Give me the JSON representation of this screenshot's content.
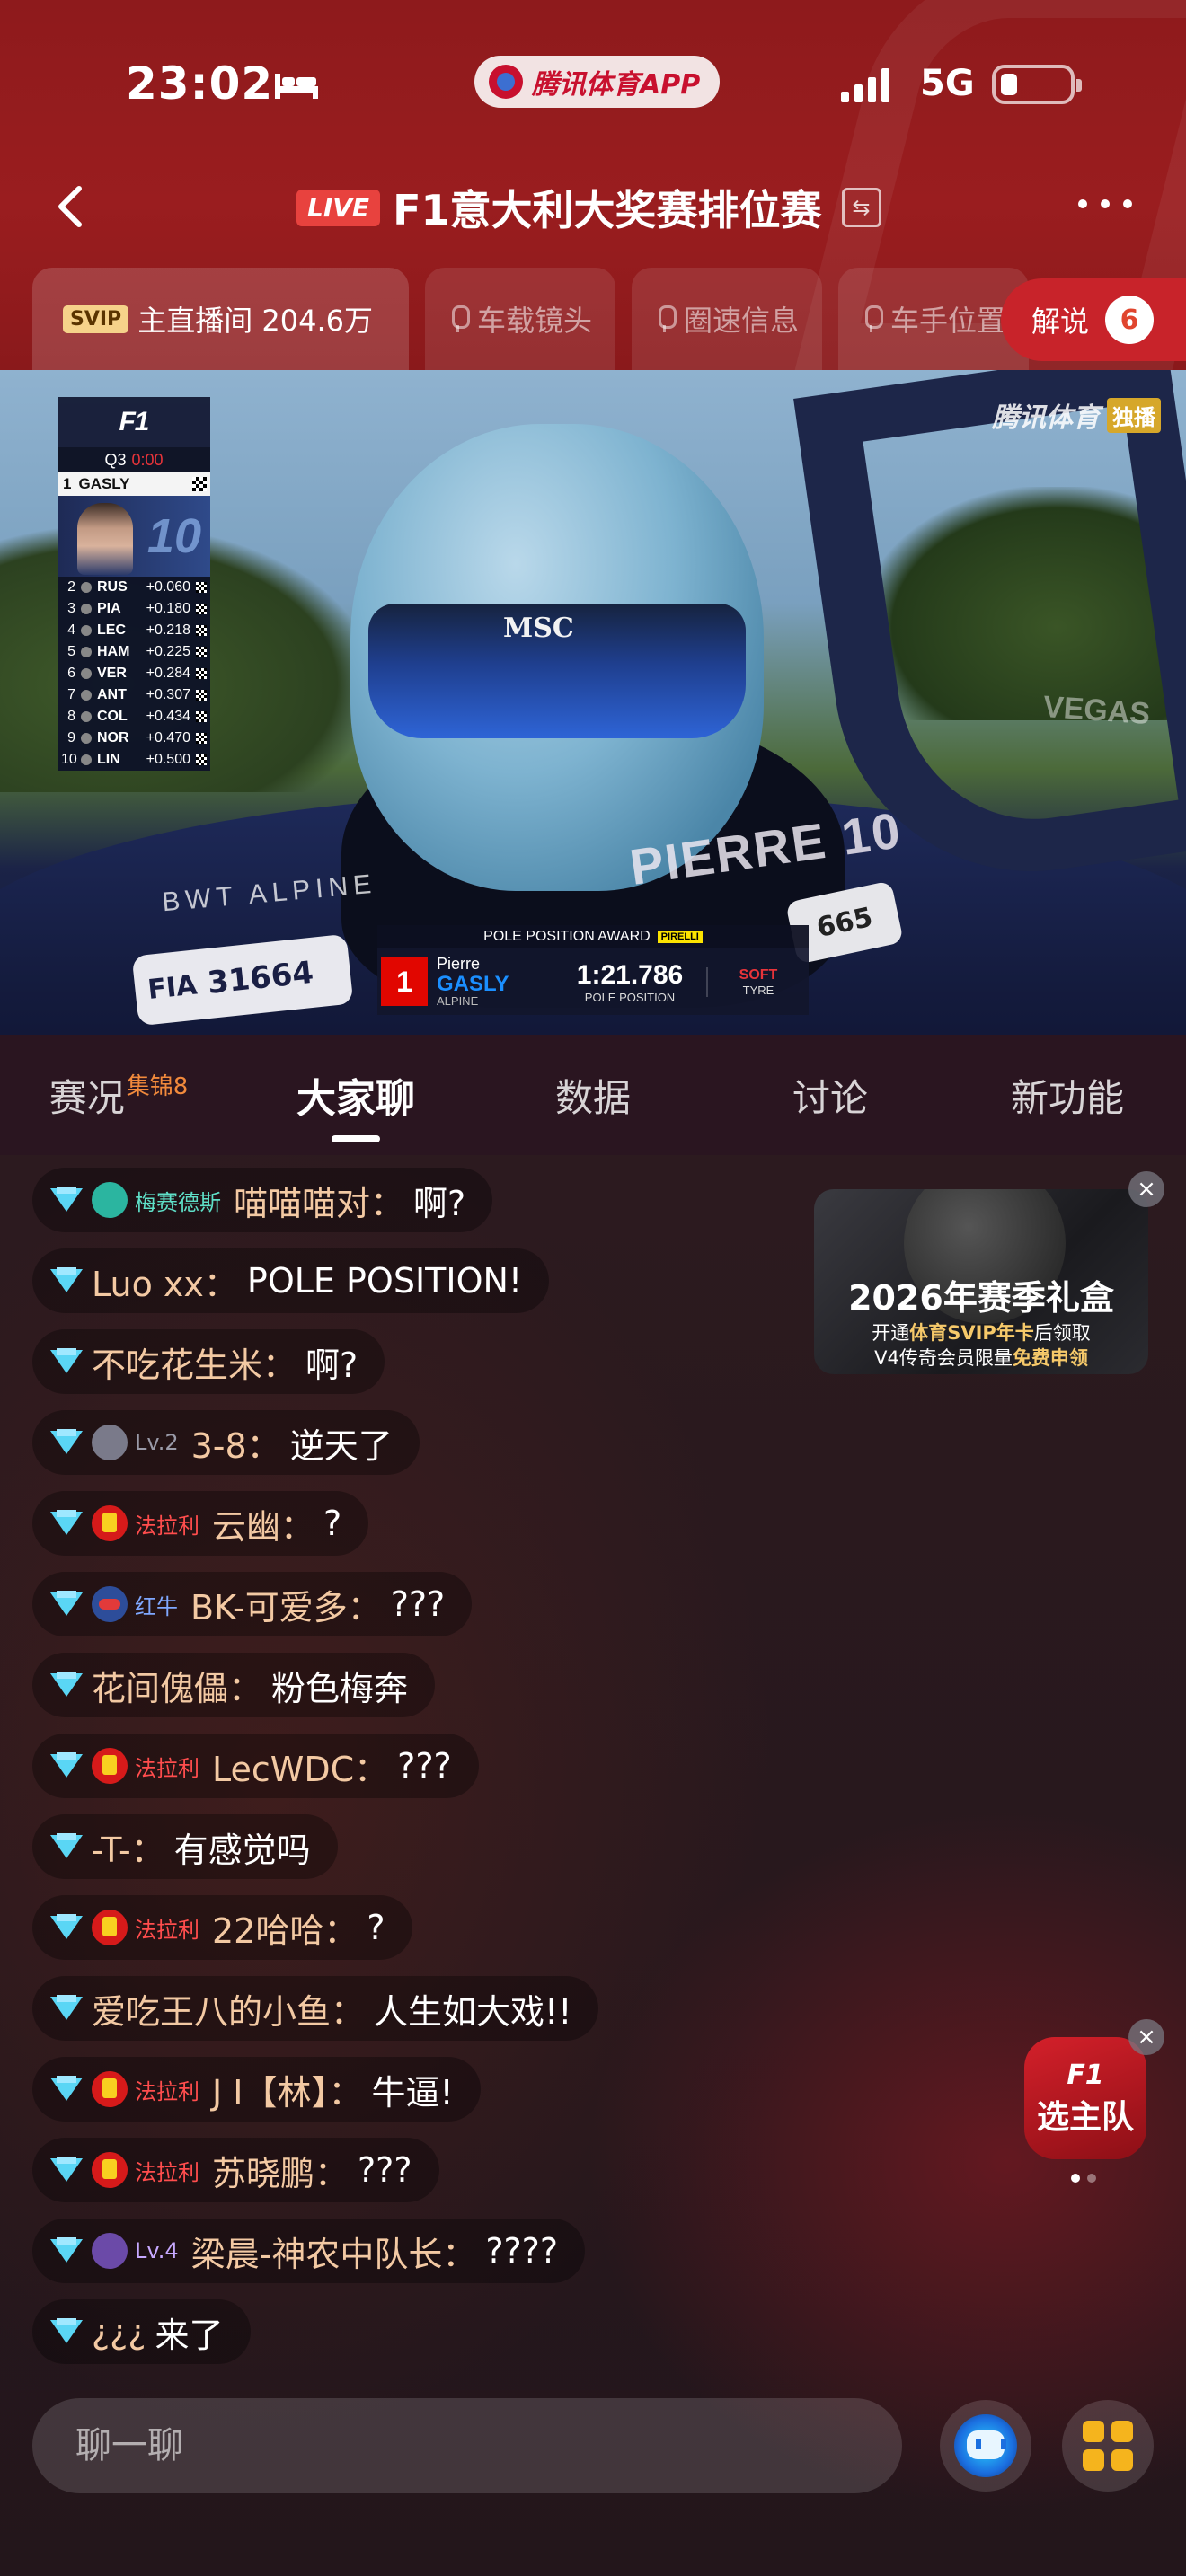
{
  "status_bar": {
    "time": "23:02",
    "network": "5G"
  },
  "app_pill": {
    "label": "腾讯体育APP"
  },
  "header": {
    "live_badge": "LIVE",
    "title": "F1意大利大奖赛排位赛"
  },
  "camera_tabs": [
    {
      "badge": "SVIP",
      "label": "主直播间 204.6万",
      "active": true
    },
    {
      "label": "车载镜头",
      "active": false
    },
    {
      "label": "圈速信息",
      "active": false
    },
    {
      "label": "车手位置",
      "active": false
    }
  ],
  "commentary": {
    "label": "解说",
    "count": "6"
  },
  "video": {
    "watermark": "腾讯体育",
    "watermark_tag": "独播",
    "helmet_brand": "MSC",
    "car_name": "PIERRE 10",
    "car_team": "BWT ALPINE",
    "fia_label": "FIA",
    "fia_number": "31664",
    "right_plate": "665",
    "trackside_ad": "VEGAS",
    "timing_tower": {
      "f1_logo": "F1",
      "session": "Q3",
      "clock": "0:00",
      "leader": {
        "pos": "1",
        "driver": "GASLY"
      },
      "photo_number": "10",
      "rows": [
        {
          "pos": "2",
          "driver": "RUS",
          "gap": "+0.060"
        },
        {
          "pos": "3",
          "driver": "PIA",
          "gap": "+0.180"
        },
        {
          "pos": "4",
          "driver": "LEC",
          "gap": "+0.218"
        },
        {
          "pos": "5",
          "driver": "HAM",
          "gap": "+0.225"
        },
        {
          "pos": "6",
          "driver": "VER",
          "gap": "+0.284"
        },
        {
          "pos": "7",
          "driver": "ANT",
          "gap": "+0.307"
        },
        {
          "pos": "8",
          "driver": "COL",
          "gap": "+0.434"
        },
        {
          "pos": "9",
          "driver": "NOR",
          "gap": "+0.470"
        },
        {
          "pos": "10",
          "driver": "LIN",
          "gap": "+0.500"
        }
      ]
    },
    "pole_award": {
      "title": "POLE POSITION AWARD",
      "sponsor": "PIRELLI",
      "position": "1",
      "first_name": "Pierre",
      "last_name": "GASLY",
      "team": "ALPINE",
      "lap_time": "1:21.786",
      "lap_label": "POLE POSITION",
      "tyre_compound": "SOFT",
      "tyre_label": "TYRE"
    }
  },
  "content_tabs": [
    {
      "label": "赛况",
      "sup": "集锦8"
    },
    {
      "label": "大家聊",
      "active": true
    },
    {
      "label": "数据"
    },
    {
      "label": "讨论"
    },
    {
      "label": "新功能"
    }
  ],
  "chat": [
    {
      "team": "梅赛德斯",
      "team_style": "merc",
      "nick": "喵喵喵对：",
      "text": "啊?"
    },
    {
      "team": "",
      "nick": "Luo xx：",
      "text": "POLE POSITION!"
    },
    {
      "team": "",
      "nick": "不吃花生米：",
      "text": "啊?"
    },
    {
      "team": "Lv.2",
      "team_style": "lv",
      "nick": "3-8：",
      "text": "逆天了"
    },
    {
      "team": "法拉利",
      "team_style": "ferr",
      "nick": "云幽：",
      "text": "?"
    },
    {
      "team": "红牛",
      "team_style": "rb",
      "nick": "BK-可爱多：",
      "text": "???"
    },
    {
      "team": "",
      "nick": "花间傀儡：",
      "text": "粉色梅奔"
    },
    {
      "team": "法拉利",
      "team_style": "ferr",
      "nick": "LecWDC：",
      "text": "???"
    },
    {
      "team": "",
      "nick": "-T-：",
      "text": "有感觉吗"
    },
    {
      "team": "法拉利",
      "team_style": "ferr",
      "nick": "22哈哈：",
      "text": "?"
    },
    {
      "team": "",
      "nick": "爱吃王八的小鱼：",
      "text": "人生如大戏!!"
    },
    {
      "team": "法拉利",
      "team_style": "ferr",
      "nick": "J I【林】：",
      "text": "牛逼!"
    },
    {
      "team": "法拉利",
      "team_style": "ferr",
      "nick": "苏晓鹏：",
      "text": "???"
    },
    {
      "team": "Lv.4",
      "team_style": "lv4",
      "nick": "梁晨-神农中队长：",
      "text": "????"
    },
    {
      "team": "",
      "nick": "¿¿¿ ",
      "text": "来了"
    }
  ],
  "promo": {
    "headline": "2026年赛季礼盒",
    "line1_a": "开通",
    "line1_b": "体育SVIP年卡",
    "line1_c": "后领取",
    "line2_a": "V4传奇会员限量",
    "line2_b": "免费申领"
  },
  "team_button": {
    "logo": "F1",
    "label": "选主队"
  },
  "input": {
    "placeholder": "聊一聊"
  },
  "colors": {
    "accent_red": "#c8232a",
    "header_red": "#9a1d1f",
    "gold": "#f5b41d"
  }
}
